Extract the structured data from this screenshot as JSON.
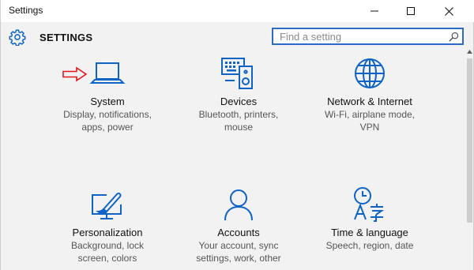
{
  "window": {
    "title": "Settings"
  },
  "header": {
    "title": "SETTINGS",
    "icon": "gear-icon"
  },
  "search": {
    "placeholder": "Find a setting",
    "value": ""
  },
  "colors": {
    "accent": "#0f63c6",
    "pointer_arrow": "#e2161d",
    "background": "#f2f2f2"
  },
  "categories": [
    {
      "title": "System",
      "line1": "Display, notifications,",
      "line2": "apps, power",
      "icon": "laptop-icon"
    },
    {
      "title": "Devices",
      "line1": "Bluetooth, printers,",
      "line2": "mouse",
      "icon": "devices-icon"
    },
    {
      "title": "Network & Internet",
      "line1": "Wi-Fi, airplane mode,",
      "line2": "VPN",
      "icon": "globe-icon"
    },
    {
      "title": "Personalization",
      "line1": "Background, lock",
      "line2": "screen, colors",
      "icon": "paintbrush-icon"
    },
    {
      "title": "Accounts",
      "line1": "Your account, sync",
      "line2": "settings, work, other",
      "icon": "person-icon"
    },
    {
      "title": "Time & language",
      "line1": "Speech, region, date",
      "line2": "",
      "icon": "clock-language-icon"
    }
  ]
}
